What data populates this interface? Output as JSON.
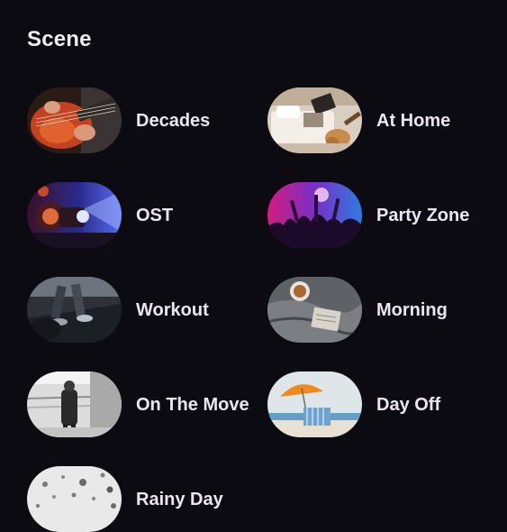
{
  "section": {
    "title": "Scene"
  },
  "scenes": [
    {
      "label": "Decades",
      "icon": "guitar-photo"
    },
    {
      "label": "At Home",
      "icon": "bedroom-guitar-photo"
    },
    {
      "label": "OST",
      "icon": "film-projector-photo"
    },
    {
      "label": "Party Zone",
      "icon": "concert-crowd-photo"
    },
    {
      "label": "Workout",
      "icon": "treadmill-photo"
    },
    {
      "label": "Morning",
      "icon": "coffee-bed-photo"
    },
    {
      "label": "On The Move",
      "icon": "subway-walker-photo"
    },
    {
      "label": "Day Off",
      "icon": "beach-umbrella-photo"
    },
    {
      "label": "Rainy Day",
      "icon": "raindrops-photo"
    }
  ]
}
